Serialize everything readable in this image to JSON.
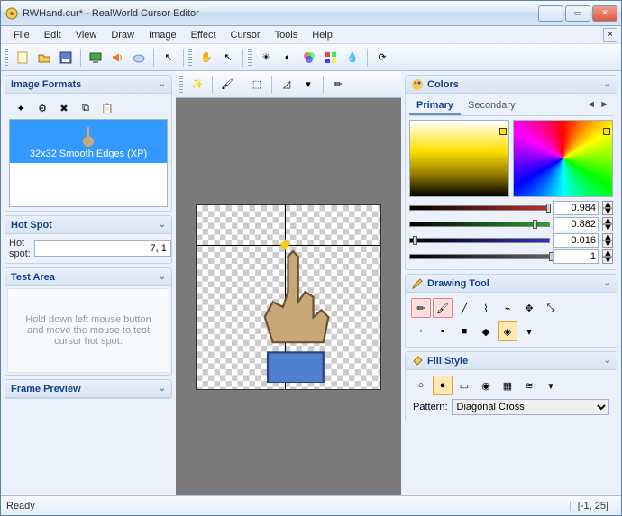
{
  "window": {
    "title": "RWHand.cur* - RealWorld Cursor Editor"
  },
  "menu": [
    "File",
    "Edit",
    "View",
    "Draw",
    "Image",
    "Effect",
    "Cursor",
    "Tools",
    "Help"
  ],
  "panels": {
    "image_formats": {
      "title": "Image Formats",
      "selected": "32x32 Smooth Edges (XP)"
    },
    "hot_spot": {
      "title": "Hot Spot",
      "label": "Hot spot:",
      "value": "7, 1"
    },
    "test_area": {
      "title": "Test Area",
      "hint": "Hold down left mouse button and move the mouse to test cursor hot spot."
    },
    "frame_preview": {
      "title": "Frame Preview"
    },
    "colors": {
      "title": "Colors",
      "tab_primary": "Primary",
      "tab_secondary": "Secondary",
      "sliders": [
        {
          "color": "#c03030",
          "thumb": 0.98,
          "value": "0.984"
        },
        {
          "color": "#30a030",
          "thumb": 0.88,
          "value": "0.882"
        },
        {
          "color": "#3030c0",
          "thumb": 0.02,
          "value": "0.016"
        },
        {
          "color": "#606060",
          "thumb": 1.0,
          "value": "1"
        }
      ]
    },
    "drawing_tool": {
      "title": "Drawing Tool"
    },
    "fill_style": {
      "title": "Fill Style",
      "pattern_label": "Pattern:",
      "pattern_value": "Diagonal Cross"
    }
  },
  "status": {
    "text": "Ready",
    "coords": "[-1, 25]"
  }
}
